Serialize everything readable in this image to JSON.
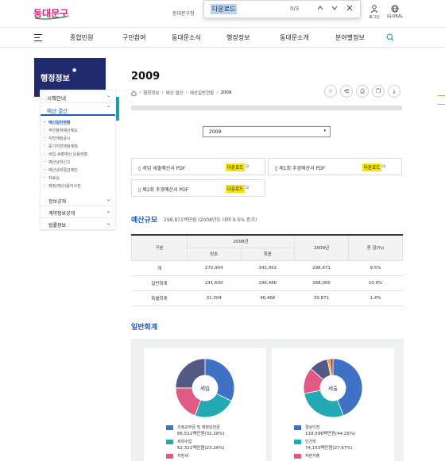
{
  "header": {
    "logo_text": "동대문구",
    "util_text": "동대문구청",
    "login_label": "로그인",
    "global_label": "GLOBAL"
  },
  "find_bar": {
    "query": "다운로드",
    "count": "0/3"
  },
  "gnb": {
    "items": [
      "종합민원",
      "구민참여",
      "동대문소식",
      "행정정보",
      "동대문소개",
      "분야별정보"
    ]
  },
  "sidebar": {
    "heading": "행정정보",
    "items": [
      {
        "label": "시책안내",
        "active": false
      },
      {
        "label": "예산·결산",
        "active": true
      }
    ],
    "sub_items": [
      {
        "label": "예산일반현황",
        "on": true
      },
      {
        "label": "주민참여예산제도",
        "on": false
      },
      {
        "label": "지방재정공시",
        "on": false
      },
      {
        "label": "중기지방재정계획",
        "on": false
      },
      {
        "label": "세입,세출예산 운용현황",
        "on": false
      },
      {
        "label": "예산낭비신고",
        "on": false
      },
      {
        "label": "예산낭비절감제안",
        "on": false
      },
      {
        "label": "자료실",
        "on": false
      },
      {
        "label": "재정(예산)용어사전",
        "on": false
      }
    ],
    "more_items": [
      "정보공개",
      "계약정보공개",
      "법률정보"
    ]
  },
  "content": {
    "title": "2009",
    "breadcrumb": [
      "행정정보",
      "예산·결산",
      "예산일반현황",
      "2009"
    ],
    "year_select": "2009",
    "downloads": [
      {
        "label": "세입 세출예산서 PDF",
        "badge": "다운로드"
      },
      {
        "label": "제1회 추경예산서 PDF",
        "badge": "다운로드"
      },
      {
        "label": "제2회 추경예산서 PDF",
        "badge": "다운로드"
      }
    ],
    "budget_title": "예산규모",
    "budget_sub": "298,871백만원 (2008년도 대비 9.5% 증가)",
    "table": {
      "col_category": "구분",
      "col_2008": "2008년",
      "col_initial": "당초",
      "col_final": "최종",
      "col_2009": "2009년",
      "col_change": "증 감(%)",
      "rows": [
        {
          "name": "계",
          "initial": "272,904",
          "final": "342,952",
          "y2009": "298,871",
          "change": "9.5%"
        },
        {
          "name": "일반회계",
          "initial": "241,600",
          "final": "296,486",
          "y2009": "268,000",
          "change": "10.9%"
        },
        {
          "name": "특별회계",
          "initial": "31,304",
          "final": "46,466",
          "y2009": "30,871",
          "change": "1.4%"
        }
      ]
    },
    "general_title": "일반회계",
    "pie_income": {
      "center_label": "세입",
      "legend": [
        {
          "label": "조정교부금 및 재정보전금",
          "value": "86,511백만원(32.28%)",
          "color": "#3f72c4"
        },
        {
          "label": "세외수입",
          "value": "62,321백만원(23.26%)",
          "color": "#23a9b3"
        },
        {
          "label": "지방세",
          "value": "",
          "color": "#e05a86"
        }
      ],
      "slices": [
        32.28,
        23.26,
        19.5,
        24.96
      ],
      "colors": [
        "#3f72c4",
        "#23a9b3",
        "#e05a86",
        "#535a86"
      ]
    },
    "pie_expense": {
      "center_label": "세출",
      "legend": [
        {
          "label": "경상이전",
          "value": "118,596백만원(44.25%)",
          "color": "#3f72c4"
        },
        {
          "label": "인건비",
          "value": "74,153백만원(27.67%)",
          "color": "#23a9b3"
        },
        {
          "label": "자본지출",
          "value": "",
          "color": "#e05a86"
        }
      ],
      "slices": [
        44.25,
        27.67,
        14.5,
        10.5,
        1.5,
        1.58
      ],
      "colors": [
        "#3f72c4",
        "#23a9b3",
        "#e05a86",
        "#535a86",
        "#f0a020",
        "#c03030"
      ]
    }
  }
}
